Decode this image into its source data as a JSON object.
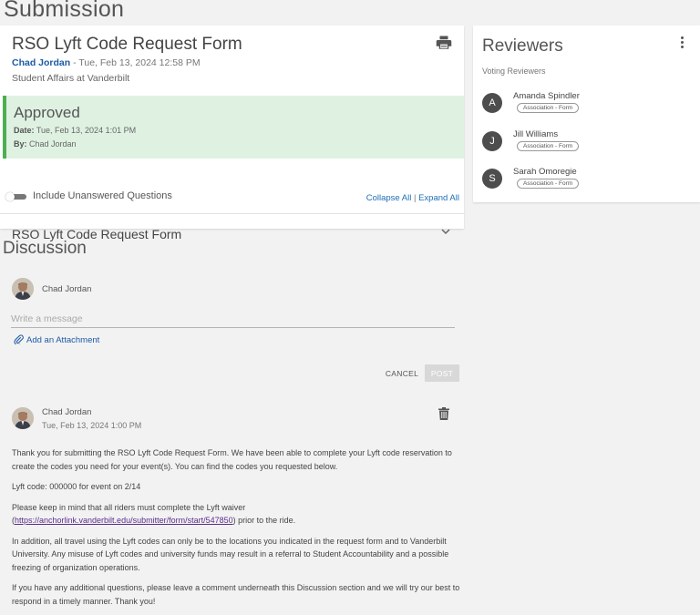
{
  "page": {
    "title": "Submission"
  },
  "submission": {
    "form_title": "RSO Lyft Code Request Form",
    "submitter_name": "Chad Jordan",
    "submitted_at": " - Tue, Feb 13, 2024 12:58 PM",
    "organization": "Student Affairs at Vanderbilt",
    "status": {
      "label": "Approved",
      "date_label": "Date:",
      "date_value": " Tue, Feb 13, 2024 1:01 PM",
      "by_label": "By:",
      "by_value": " Chad Jordan",
      "color": "#4caf50"
    },
    "include_unanswered_label": "Include Unanswered Questions",
    "include_unanswered_on": false,
    "collapse_all": "Collapse All",
    "separator": " | ",
    "expand_all": "Expand All",
    "section_title": "RSO Lyft Code Request Form"
  },
  "reviewers": {
    "title": "Reviewers",
    "subtitle": "Voting Reviewers",
    "items": [
      {
        "initial": "A",
        "name": "Amanda Spindler",
        "badge": "Association - Form"
      },
      {
        "initial": "J",
        "name": "Jill Williams",
        "badge": "Association - Form"
      },
      {
        "initial": "S",
        "name": "Sarah Omoregie",
        "badge": "Association - Form"
      }
    ]
  },
  "discussion": {
    "title": "Discussion",
    "composer": {
      "user_name": "Chad Jordan",
      "placeholder": "Write a message",
      "attach_label": "Add an Attachment",
      "cancel_label": "CANCEL",
      "post_label": "POST"
    },
    "comments": [
      {
        "author": "Chad Jordan",
        "date": "Tue, Feb 13, 2024 1:00 PM",
        "p1": "Thank you for submitting the RSO Lyft Code Request Form. We have been able to complete your Lyft code reservation to create the codes you need for your event(s). You can find the codes you requested below.",
        "p2": "Lyft code: 000000 for event on 2/14",
        "p3_before": "Please keep in mind that all riders must complete the Lyft waiver (",
        "p3_link": "https://anchorlink.vanderbilt.edu/submitter/form/start/547850",
        "p3_after": ") prior to the ride.",
        "p4": "In addition, all travel using the Lyft codes can only be to the locations you indicated in the request form and to Vanderbilt University. Any misuse of Lyft codes and university funds may result in a referral to Student Accountability and a possible freezing of organization operations.",
        "p5": "If you have any additional questions, please leave a comment underneath this Discussion section and we will try our best to respond in a timely manner. Thank you!"
      }
    ]
  },
  "icons": {
    "print": "print-icon",
    "chevron": "chevron-down-icon",
    "kebab": "more-vert-icon",
    "paperclip": "paperclip-icon",
    "trash": "trash-icon"
  }
}
